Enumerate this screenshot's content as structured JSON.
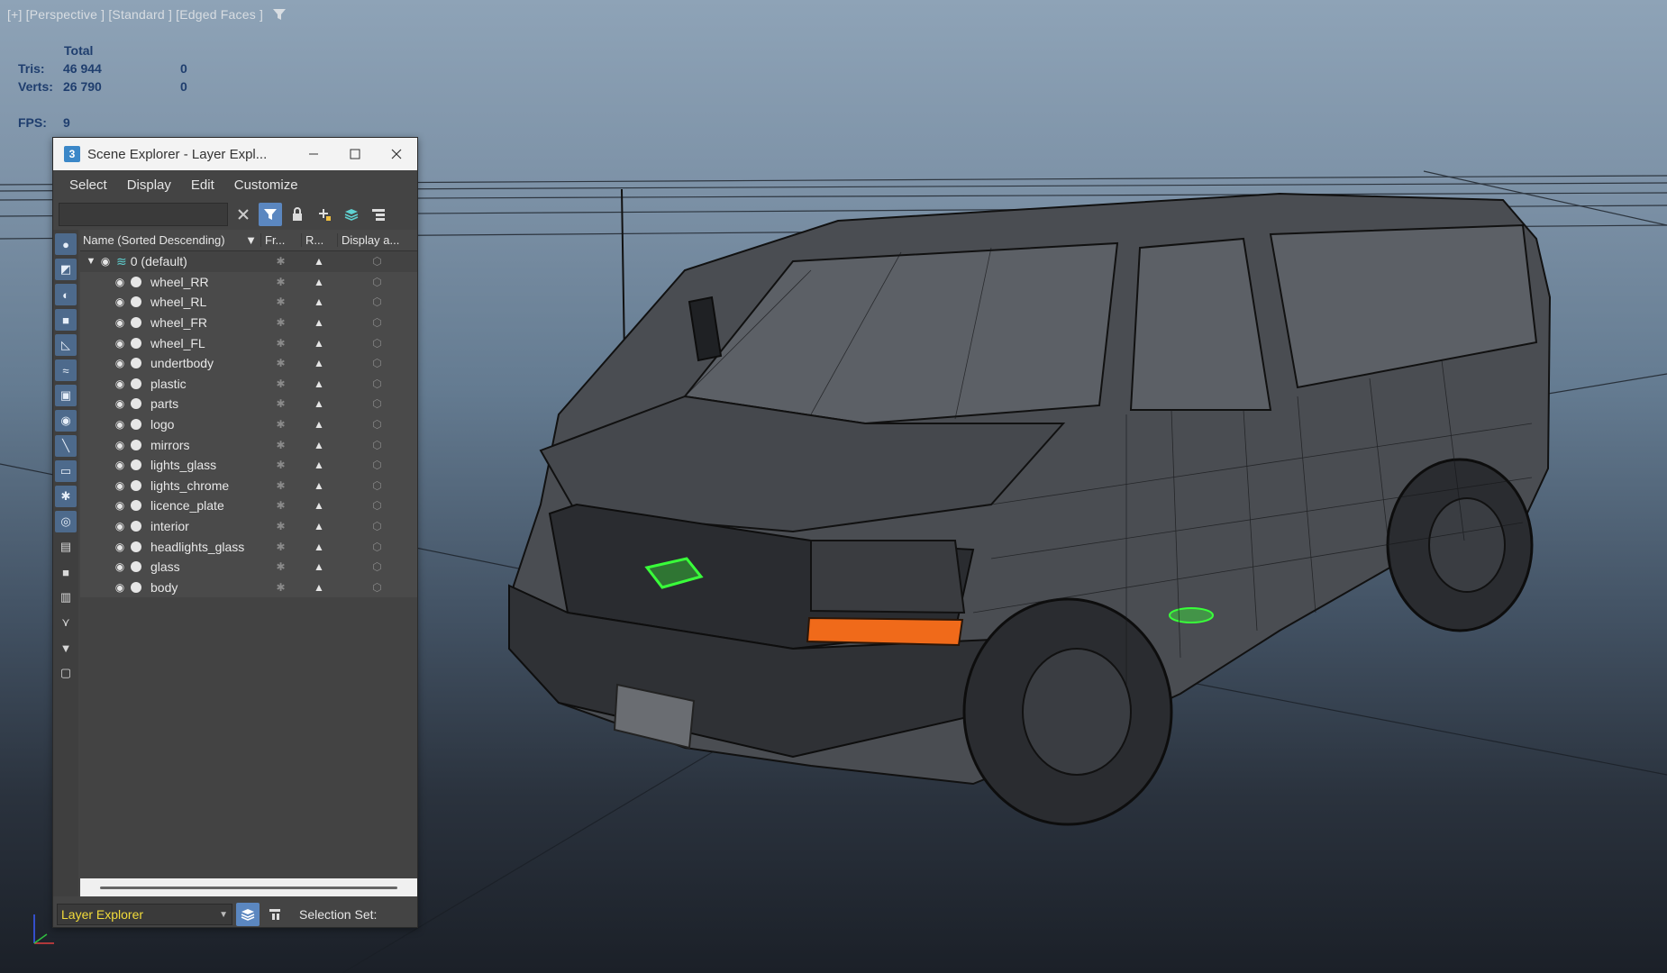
{
  "viewport": {
    "label": "[+] [Perspective ] [Standard ] [Edged Faces ]",
    "filter_icon": "funnel-icon",
    "stats": {
      "total_label": "Total",
      "tris_label": "Tris:",
      "tris_value": "46 944",
      "tris_sel": "0",
      "verts_label": "Verts:",
      "verts_value": "26 790",
      "verts_sel": "0",
      "fps_label": "FPS:",
      "fps_value": "9"
    }
  },
  "scene_explorer": {
    "title": "Scene Explorer - Layer Expl...",
    "app_icon_text": "3",
    "menu": [
      "Select",
      "Display",
      "Edit",
      "Customize"
    ],
    "search_value": "",
    "columns": {
      "name": "Name (Sorted Descending)",
      "sort_arrow": "▼",
      "fr": "Fr...",
      "r": "R...",
      "display": "Display a..."
    },
    "root_layer": "0 (default)",
    "layers": [
      "wheel_RR",
      "wheel_RL",
      "wheel_FR",
      "wheel_FL",
      "undertbody",
      "plastic",
      "parts",
      "logo",
      "mirrors",
      "lights_glass",
      "lights_chrome",
      "licence_plate",
      "interior",
      "headlights_glass",
      "glass",
      "body"
    ],
    "explorer_type": "Layer Explorer",
    "selection_set_label": "Selection Set:"
  },
  "colors": {
    "accent_blue": "#5b87c0",
    "selected_layer_green": "#39ff3a",
    "explorer_text_yellow": "#f2dc3a"
  }
}
